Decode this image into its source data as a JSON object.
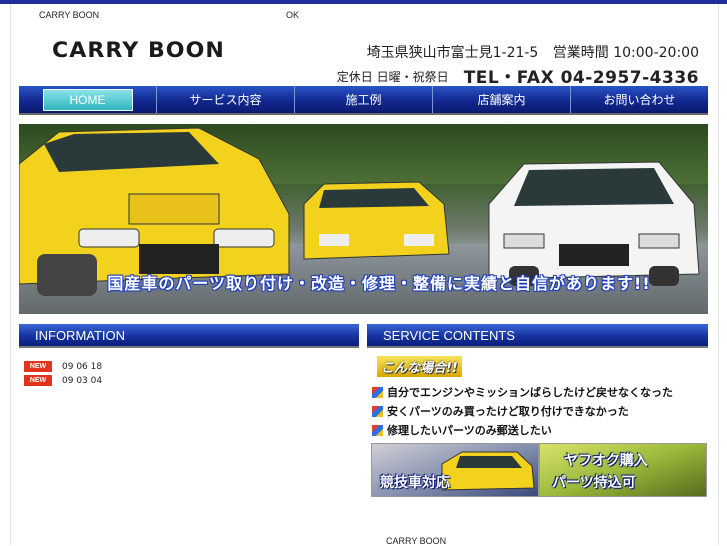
{
  "header": {
    "left_text": "CARRY BOON",
    "ok_text": "OK",
    "logo": "CARRY BOON",
    "address": "埼玉県狭山市富士見1-21-5",
    "hours": "営業時間 10:00-20:00",
    "holiday": "定休日 日曜・祝祭日",
    "tel": "TEL・FAX 04-2957-4336"
  },
  "nav": {
    "items": [
      {
        "label": "HOME"
      },
      {
        "label": "サービス内容"
      },
      {
        "label": "施工例"
      },
      {
        "label": "店舗案内"
      },
      {
        "label": "お問い合わせ"
      }
    ]
  },
  "hero": {
    "caption": "国産車のパーツ取り付け・改造・修理・整備に実績と自信があります!!",
    "colors": {
      "car_yellow": "#f2d21c",
      "car_white": "#f2f2f2",
      "accent_blue": "#1f3fbf"
    }
  },
  "information": {
    "title": "INFORMATION",
    "badge": "NEW",
    "items": [
      {
        "date": "09 06 18"
      },
      {
        "date": "09 03 04"
      }
    ]
  },
  "service": {
    "title": "SERVICE CONTENTS",
    "case_title": "こんな場合!!",
    "cases": [
      "自分でエンジンやミッションばらしたけど戻せなくなった",
      "安くパーツのみ買ったけど取り付けできなかった",
      "修理したいパーツのみ郵送したい"
    ],
    "banners": [
      {
        "label": "競技車対応"
      },
      {
        "label1": "ヤフオク購入",
        "label2": "パーツ持込可"
      }
    ]
  },
  "footer": {
    "name": "CARRY BOON"
  }
}
